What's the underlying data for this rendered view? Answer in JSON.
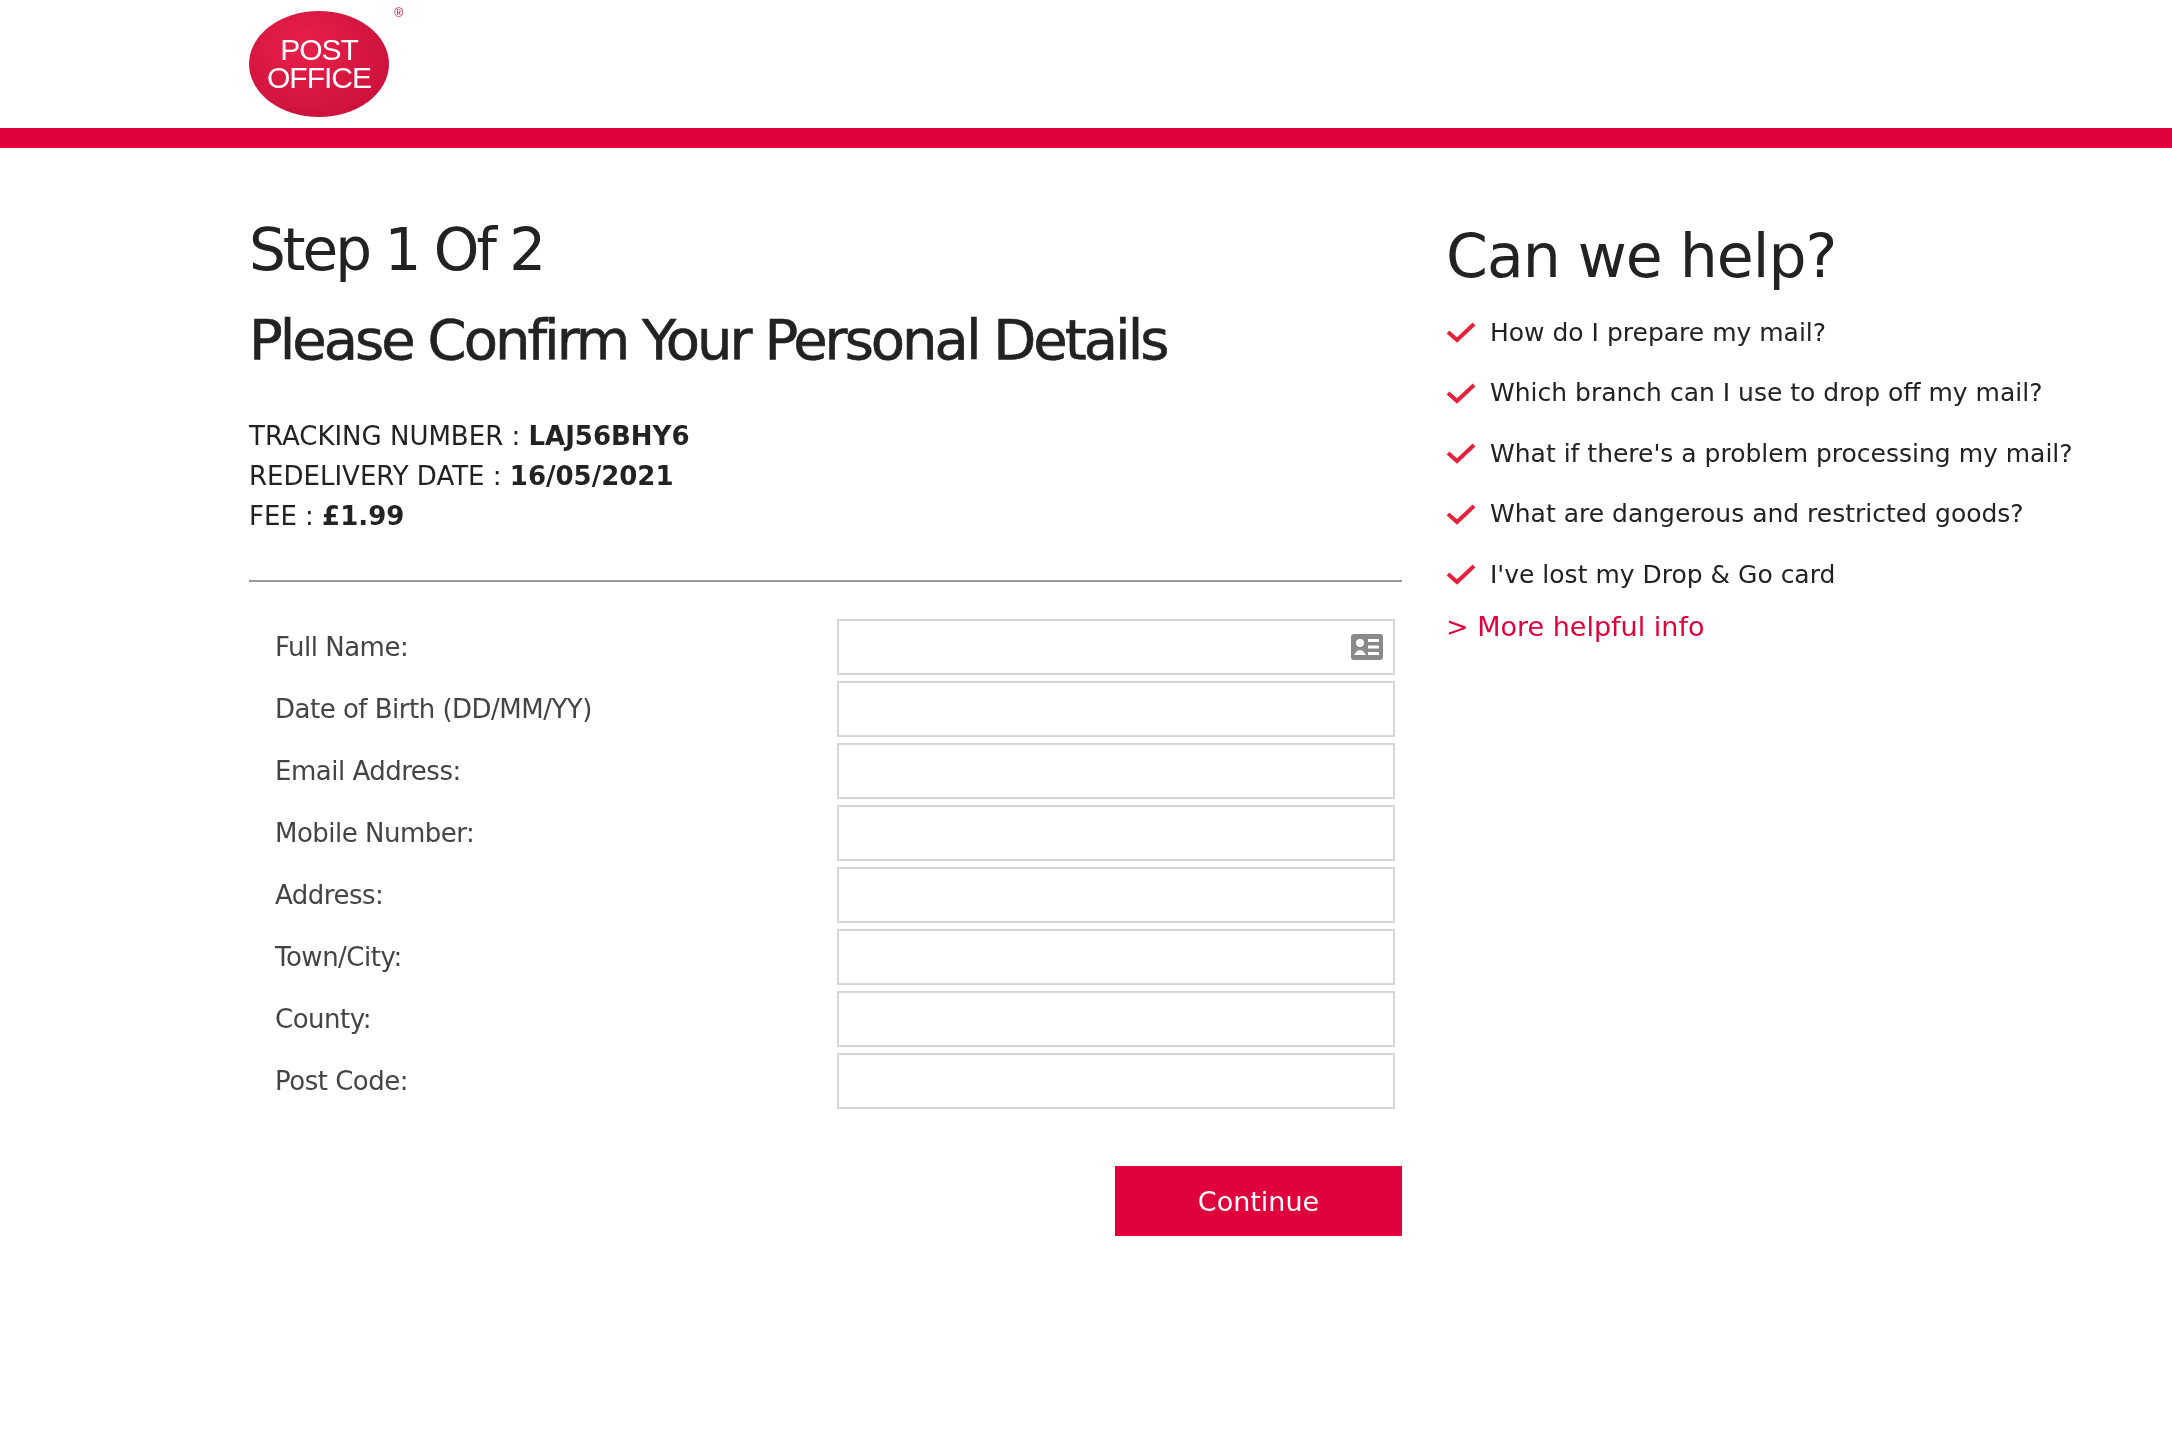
{
  "logo": {
    "line_1": "POST",
    "line_2": "OFFICE",
    "mark": "®"
  },
  "step": "Step 1 Of 2",
  "heading": "Please Confirm Your Personal Details",
  "details": [
    {
      "label": "TRACKING NUMBER : ",
      "value": "LAJ56BHY6"
    },
    {
      "label": "REDELIVERY DATE : ",
      "value": "16/05/2021"
    },
    {
      "label": "FEE : ",
      "value": "£1.99"
    }
  ],
  "fields": [
    {
      "label": "Full Name:",
      "contact_card": true
    },
    {
      "label": "Date of Birth (DD/MM/YY)",
      "contact_card": false
    },
    {
      "label": "Email Address:",
      "contact_card": false
    },
    {
      "label": "Mobile Number:",
      "contact_card": false
    },
    {
      "label": "Address:",
      "contact_card": false
    },
    {
      "label": "Town/City:",
      "contact_card": false
    },
    {
      "label": "County:",
      "contact_card": false
    },
    {
      "label": "Post Code:",
      "contact_card": false
    }
  ],
  "continue_button": "Continue",
  "help": {
    "title": "Can we help?",
    "items": [
      "How do I prepare my mail?",
      "Which branch can I use to drop off my mail?",
      "What if there's a problem processing my mail?",
      "What are dangerous and restricted goods?",
      "I've lost my Drop & Go card"
    ],
    "more_link": "> More helpful info"
  }
}
